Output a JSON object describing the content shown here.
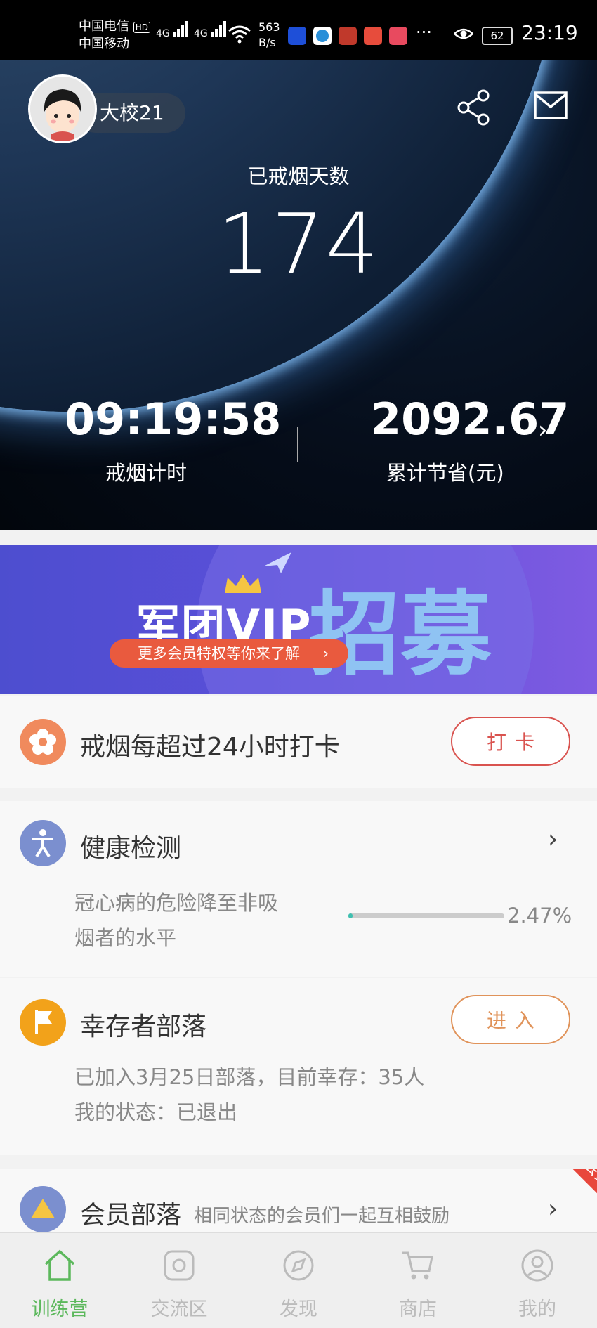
{
  "status_bar": {
    "carrier1": "中国电信",
    "carrier2": "中国移动",
    "hd": "HD",
    "net1": "4G",
    "net2": "4G",
    "speed_value": "563",
    "speed_unit": "B/s",
    "more": "···",
    "battery": "62",
    "time": "23:19"
  },
  "hero": {
    "username": "大校21",
    "days_label": "已戒烟天数",
    "days": "174",
    "timer": "09:19:58",
    "timer_label": "戒烟计时",
    "saved": "2092.67",
    "saved_label": "累计节省(元)"
  },
  "banner": {
    "title": "军团VIP",
    "big_text": "招募",
    "pill": "更多会员特权等你来了解"
  },
  "checkin": {
    "title": "戒烟每超过24小时打卡",
    "button": "打卡"
  },
  "health": {
    "title": "健康检测",
    "desc_line1": "冠心病的危险降至非吸",
    "desc_line2": "烟者的水平",
    "progress_text": "2.47%",
    "progress": 0.0247
  },
  "tribe": {
    "title": "幸存者部落",
    "button": "进入",
    "line1": "已加入3月25日部落，目前幸存：35人",
    "line2": "我的状态：已退出"
  },
  "member": {
    "title": "会员部落",
    "subtitle": "相同状态的会员们一起互相鼓励",
    "ribbon": "会员"
  },
  "nav": {
    "items": [
      {
        "label": "训练营"
      },
      {
        "label": "交流区"
      },
      {
        "label": "发现"
      },
      {
        "label": "商店"
      },
      {
        "label": "我的"
      }
    ]
  },
  "colors": {
    "accent_green": "#5cb85c",
    "checkin_red": "#d9534f",
    "tribe_orange": "#e0935a",
    "progress_teal": "#3fc0b0"
  }
}
